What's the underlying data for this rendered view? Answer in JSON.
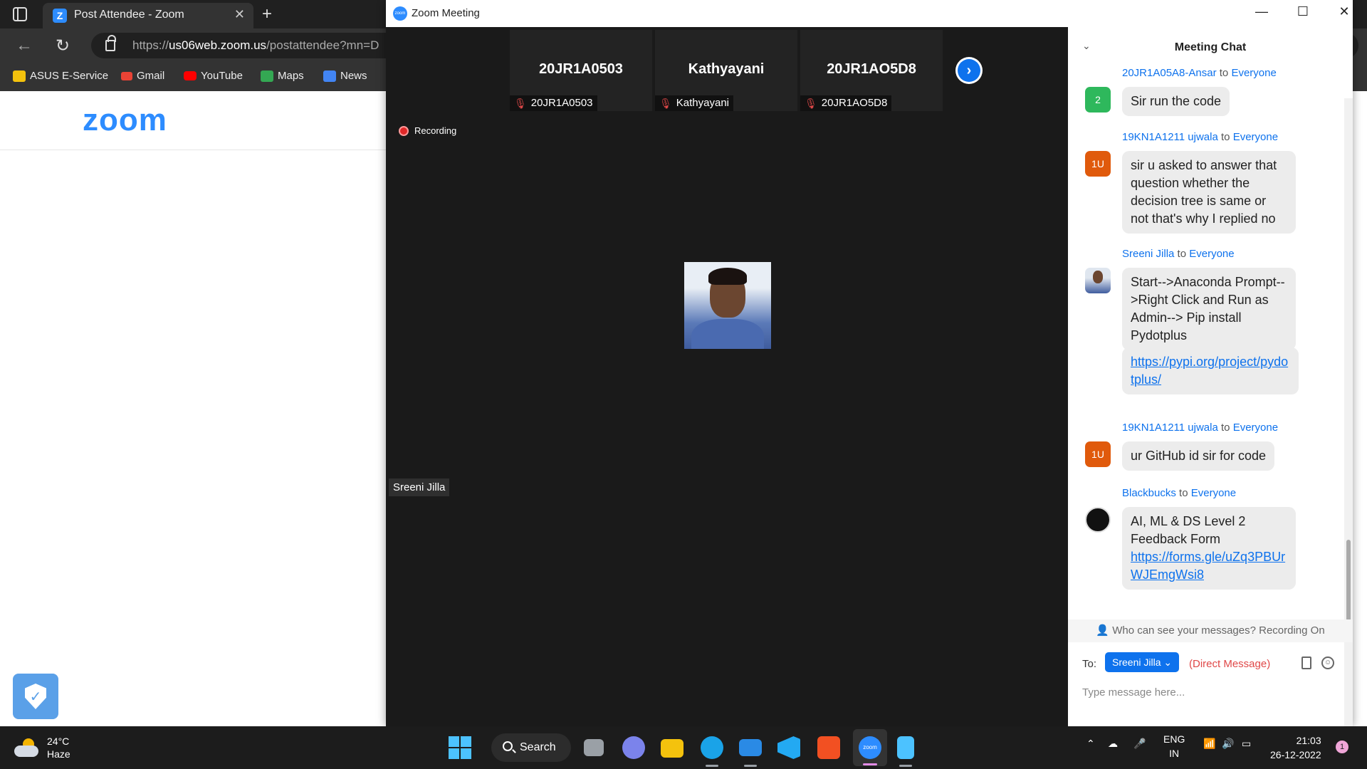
{
  "browser": {
    "tab_title": "Post Attendee - Zoom",
    "url_prefix": "https://",
    "url_host": "us06web.zoom.us",
    "url_path": "/postattendee?mn=D",
    "bookmarks": [
      "ASUS E-Service",
      "Gmail",
      "YouTube",
      "Maps",
      "News"
    ],
    "page_logo": "zoom"
  },
  "zoom": {
    "window_title": "Zoom Meeting",
    "thumbnails": [
      {
        "name": "20JR1A0503",
        "label": "20JR1A0503"
      },
      {
        "name": "Kathyayani",
        "label": "Kathyayani"
      },
      {
        "name": "20JR1AO5D8",
        "label": "20JR1AO5D8"
      }
    ],
    "recording_label": "Recording",
    "active_speaker": "Sreeni Jilla"
  },
  "chat": {
    "title": "Meeting Chat",
    "to_word": "to",
    "messages": [
      {
        "sender": "20JR1A05A8-Ansar",
        "recipient": "Everyone",
        "avatar": "2",
        "avatar_color": "#2eb85c",
        "texts": [
          "Sir run the code"
        ]
      },
      {
        "sender": "19KN1A1211 ujwala",
        "recipient": "Everyone",
        "avatar": "1U",
        "avatar_color": "#e05a0c",
        "texts": [
          "sir u asked to answer that question whether the decision tree is same or not that's why I replied no"
        ]
      },
      {
        "sender": "Sreeni Jilla",
        "recipient": "Everyone",
        "avatar": "",
        "texts": [
          "Start-->Anaconda Prompt-->Right Click and Run as Admin--> Pip install Pydotplus",
          "https://pypi.org/project/pydotplus/"
        ]
      },
      {
        "sender": "19KN1A1211 ujwala",
        "recipient": "Everyone",
        "avatar": "1U",
        "avatar_color": "#e05a0c",
        "texts": [
          "ur GitHub id sir for code"
        ]
      },
      {
        "sender": "Blackbucks",
        "recipient": "Everyone",
        "avatar": "",
        "texts": [
          "AI, ML & DS Level 2 Feedback Form",
          "https://forms.gle/uZq3PBUrWJEmgWsi8"
        ]
      }
    ],
    "who_can_see": "Who can see your messages? Recording On",
    "to_label": "To:",
    "to_recipient": "Sreeni Jilla",
    "direct_message_label": "(Direct Message)",
    "input_placeholder": "Type message here..."
  },
  "taskbar": {
    "weather_temp": "24°C",
    "weather_desc": "Haze",
    "search_label": "Search",
    "lang_line1": "ENG",
    "lang_line2": "IN",
    "time": "21:03",
    "date": "26-12-2022",
    "notification_count": "1"
  }
}
